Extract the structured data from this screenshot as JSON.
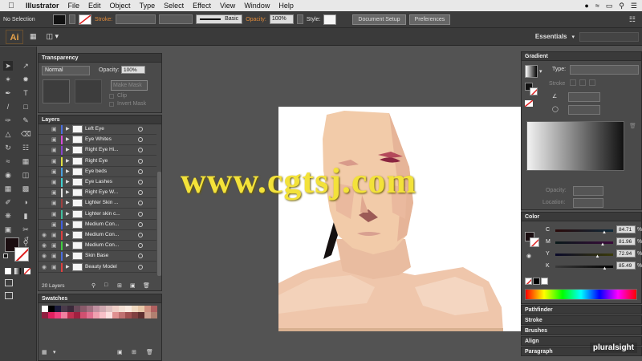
{
  "menubar": {
    "app_name": "Illustrator",
    "items": [
      "File",
      "Edit",
      "Object",
      "Type",
      "Select",
      "Effect",
      "View",
      "Window",
      "Help"
    ]
  },
  "control_bar": {
    "selection_label": "No Selection",
    "stroke_label": "Stroke:",
    "brush_label": "Basic",
    "opacity_label": "Opacity:",
    "opacity_value": "100%",
    "style_label": "Style:",
    "document_setup": "Document Setup",
    "preferences": "Preferences"
  },
  "app_bar": {
    "logo": "Ai",
    "workspace": "Essentials"
  },
  "transparency": {
    "title": "Transparency",
    "blend_mode": "Normal",
    "opacity_label": "Opacity:",
    "opacity_value": "100%",
    "make_mask": "Make Mask",
    "clip": "Clip",
    "invert_mask": "Invert Mask"
  },
  "layers": {
    "title": "Layers",
    "count": "20 Layers",
    "rows": [
      {
        "name": "Left Eye",
        "color": "#4a6ee0"
      },
      {
        "name": "Eye Whites",
        "color": "#d84ad8"
      },
      {
        "name": "Right Eye Hi...",
        "color": "#8844cc"
      },
      {
        "name": "Right Eye",
        "color": "#e0e040"
      },
      {
        "name": "Eye beds",
        "color": "#4aa0e0"
      },
      {
        "name": "Eye Lashes",
        "color": "#40d0d0"
      },
      {
        "name": "Right Eye W...",
        "color": "#e0e0e0"
      },
      {
        "name": "Lighter Skin ...",
        "color": "#a04040"
      },
      {
        "name": "Lighter skin c...",
        "color": "#40c0a0"
      },
      {
        "name": "Medium Con...",
        "color": "#4060e0"
      },
      {
        "name": "Medium Con...",
        "color": "#e04040"
      },
      {
        "name": "Medium Con...",
        "color": "#40d040"
      },
      {
        "name": "Skin Base",
        "color": "#4a6ee0"
      },
      {
        "name": "Beauty Model",
        "color": "#e04040"
      }
    ]
  },
  "swatches": {
    "title": "Swatches"
  },
  "gradient": {
    "title": "Gradient",
    "type_label": "Type:",
    "stroke_label": "Stroke",
    "opacity_label": "Opacity:",
    "location_label": "Location:"
  },
  "color": {
    "title": "Color",
    "channels": [
      {
        "label": "C",
        "value": "84.71",
        "unit": "%"
      },
      {
        "label": "M",
        "value": "81.96",
        "unit": "%"
      },
      {
        "label": "Y",
        "value": "72.94",
        "unit": "%"
      },
      {
        "label": "K",
        "value": "85.49",
        "unit": "%"
      }
    ]
  },
  "collapsed_panels": [
    "Pathfinder",
    "Stroke",
    "Brushes",
    "Align",
    "Paragraph"
  ],
  "watermark": "www.cgtsj.com",
  "brand_badge": "pluralsight"
}
